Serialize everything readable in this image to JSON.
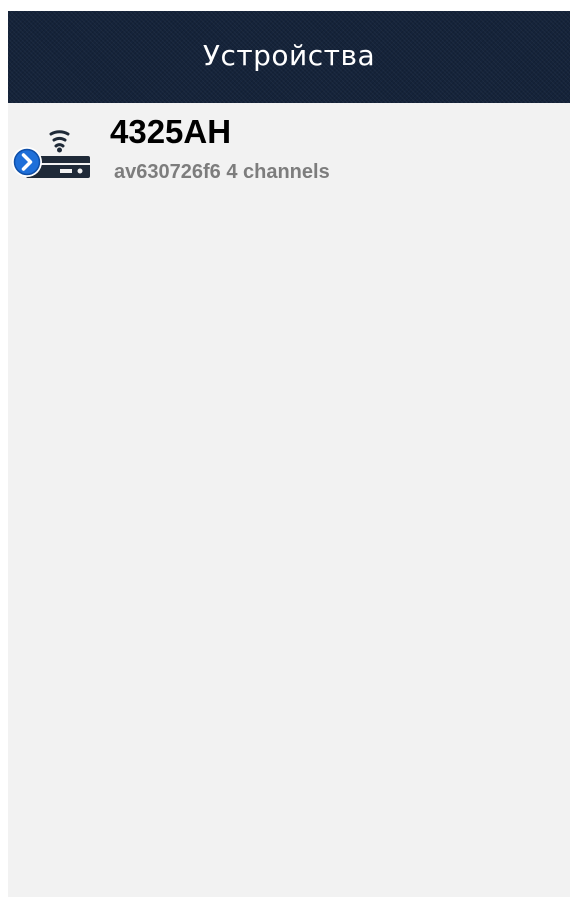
{
  "header": {
    "title": "Устройства"
  },
  "devices": [
    {
      "name": "4325AH",
      "id": "av630726f6",
      "channels": "4 channels",
      "info": "av630726f6 4 channels",
      "icon": "dvr-wifi-icon",
      "badge_icon": "chevron-right-circle-icon"
    }
  ],
  "colors": {
    "header_bg": "#15233a",
    "header_text": "#ffffff",
    "screen_bg": "#f2f2f2",
    "device_icon": "#1f2a38",
    "badge": "#1e6fd9",
    "name_text": "#000000",
    "info_text": "#7d7d7d"
  }
}
